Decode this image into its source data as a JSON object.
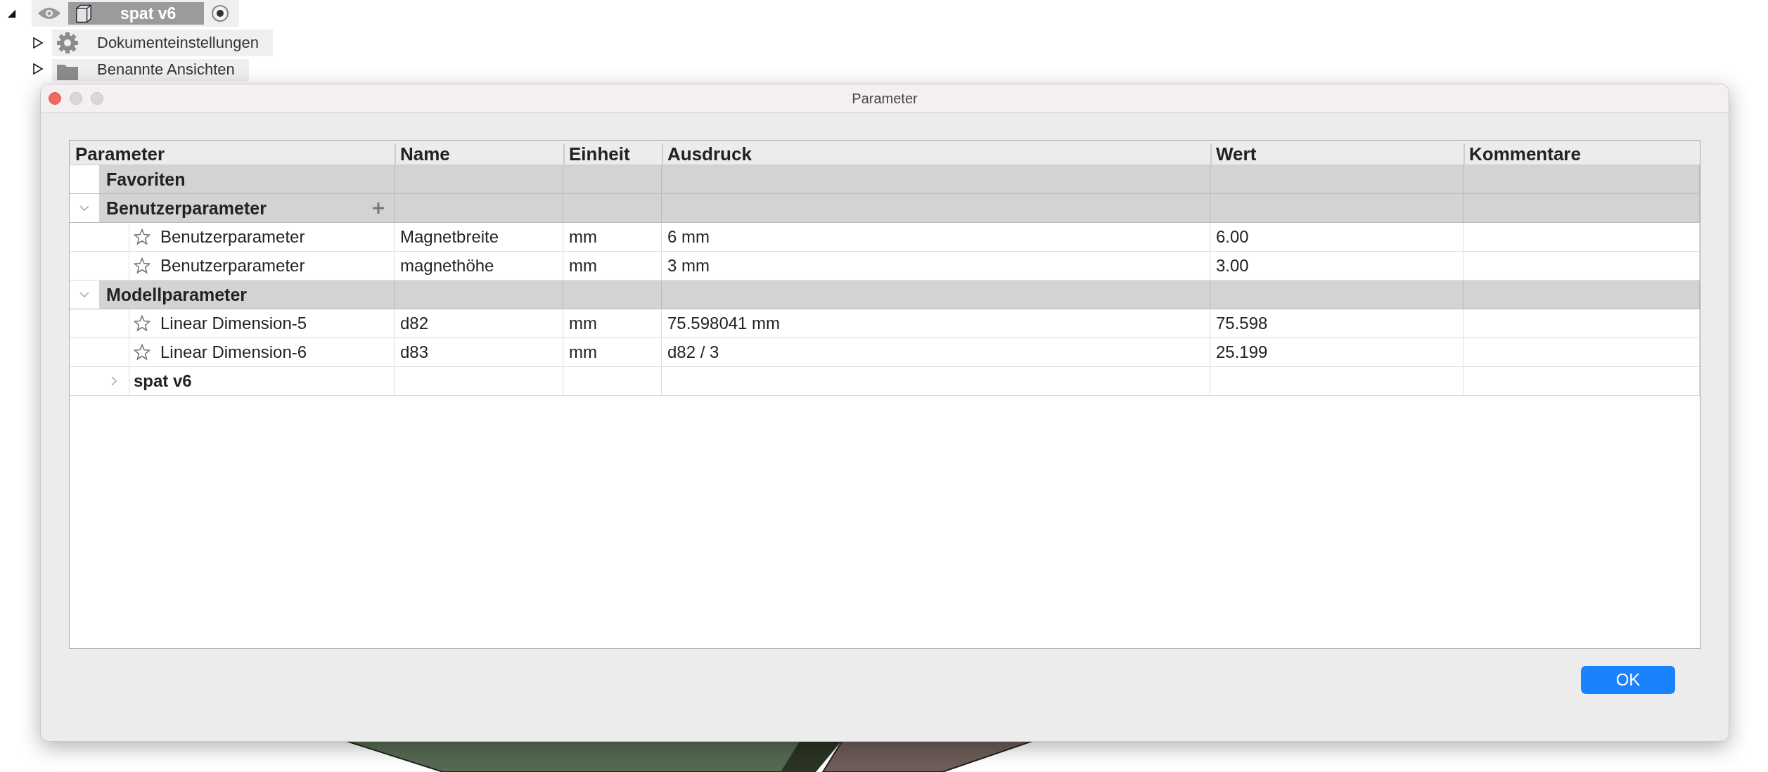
{
  "browser_tree": [
    {
      "label": "spat v6",
      "kind": "root",
      "expanded": true
    },
    {
      "label": "Dokumenteinstellungen",
      "kind": "settings",
      "expanded": false
    },
    {
      "label": "Benannte Ansichten",
      "kind": "folder",
      "expanded": false
    }
  ],
  "dialog": {
    "title": "Parameter",
    "columns": [
      "Parameter",
      "Name",
      "Einheit",
      "Ausdruck",
      "Wert",
      "Kommentare"
    ],
    "groups": [
      {
        "label": "Favoriten"
      },
      {
        "label": "Benutzerparameter",
        "expanded": true,
        "add_button": true,
        "children": [
          {
            "kind": "parameter",
            "favorite": false,
            "parameter": "Benutzerparameter",
            "name": "Magnetbreite",
            "unit": "mm",
            "expression": "6 mm",
            "value": "6.00"
          },
          {
            "kind": "parameter",
            "favorite": false,
            "parameter": "Benutzerparameter",
            "name": "magnethöhe",
            "unit": "mm",
            "expression": "3 mm",
            "value": "3.00"
          }
        ]
      },
      {
        "label": "Modellparameter",
        "expanded": true,
        "children": [
          {
            "kind": "parameter",
            "favorite": false,
            "parameter": "Linear Dimension-5",
            "name": "d82",
            "unit": "mm",
            "expression": "75.598041 mm",
            "value": "75.598"
          },
          {
            "kind": "parameter",
            "favorite": false,
            "parameter": "Linear Dimension-6",
            "name": "d83",
            "unit": "mm",
            "expression": "d82 / 3",
            "value": "25.199"
          },
          {
            "kind": "component",
            "label": "spat v6",
            "expanded": false
          }
        ]
      }
    ],
    "ok_button": "OK"
  }
}
